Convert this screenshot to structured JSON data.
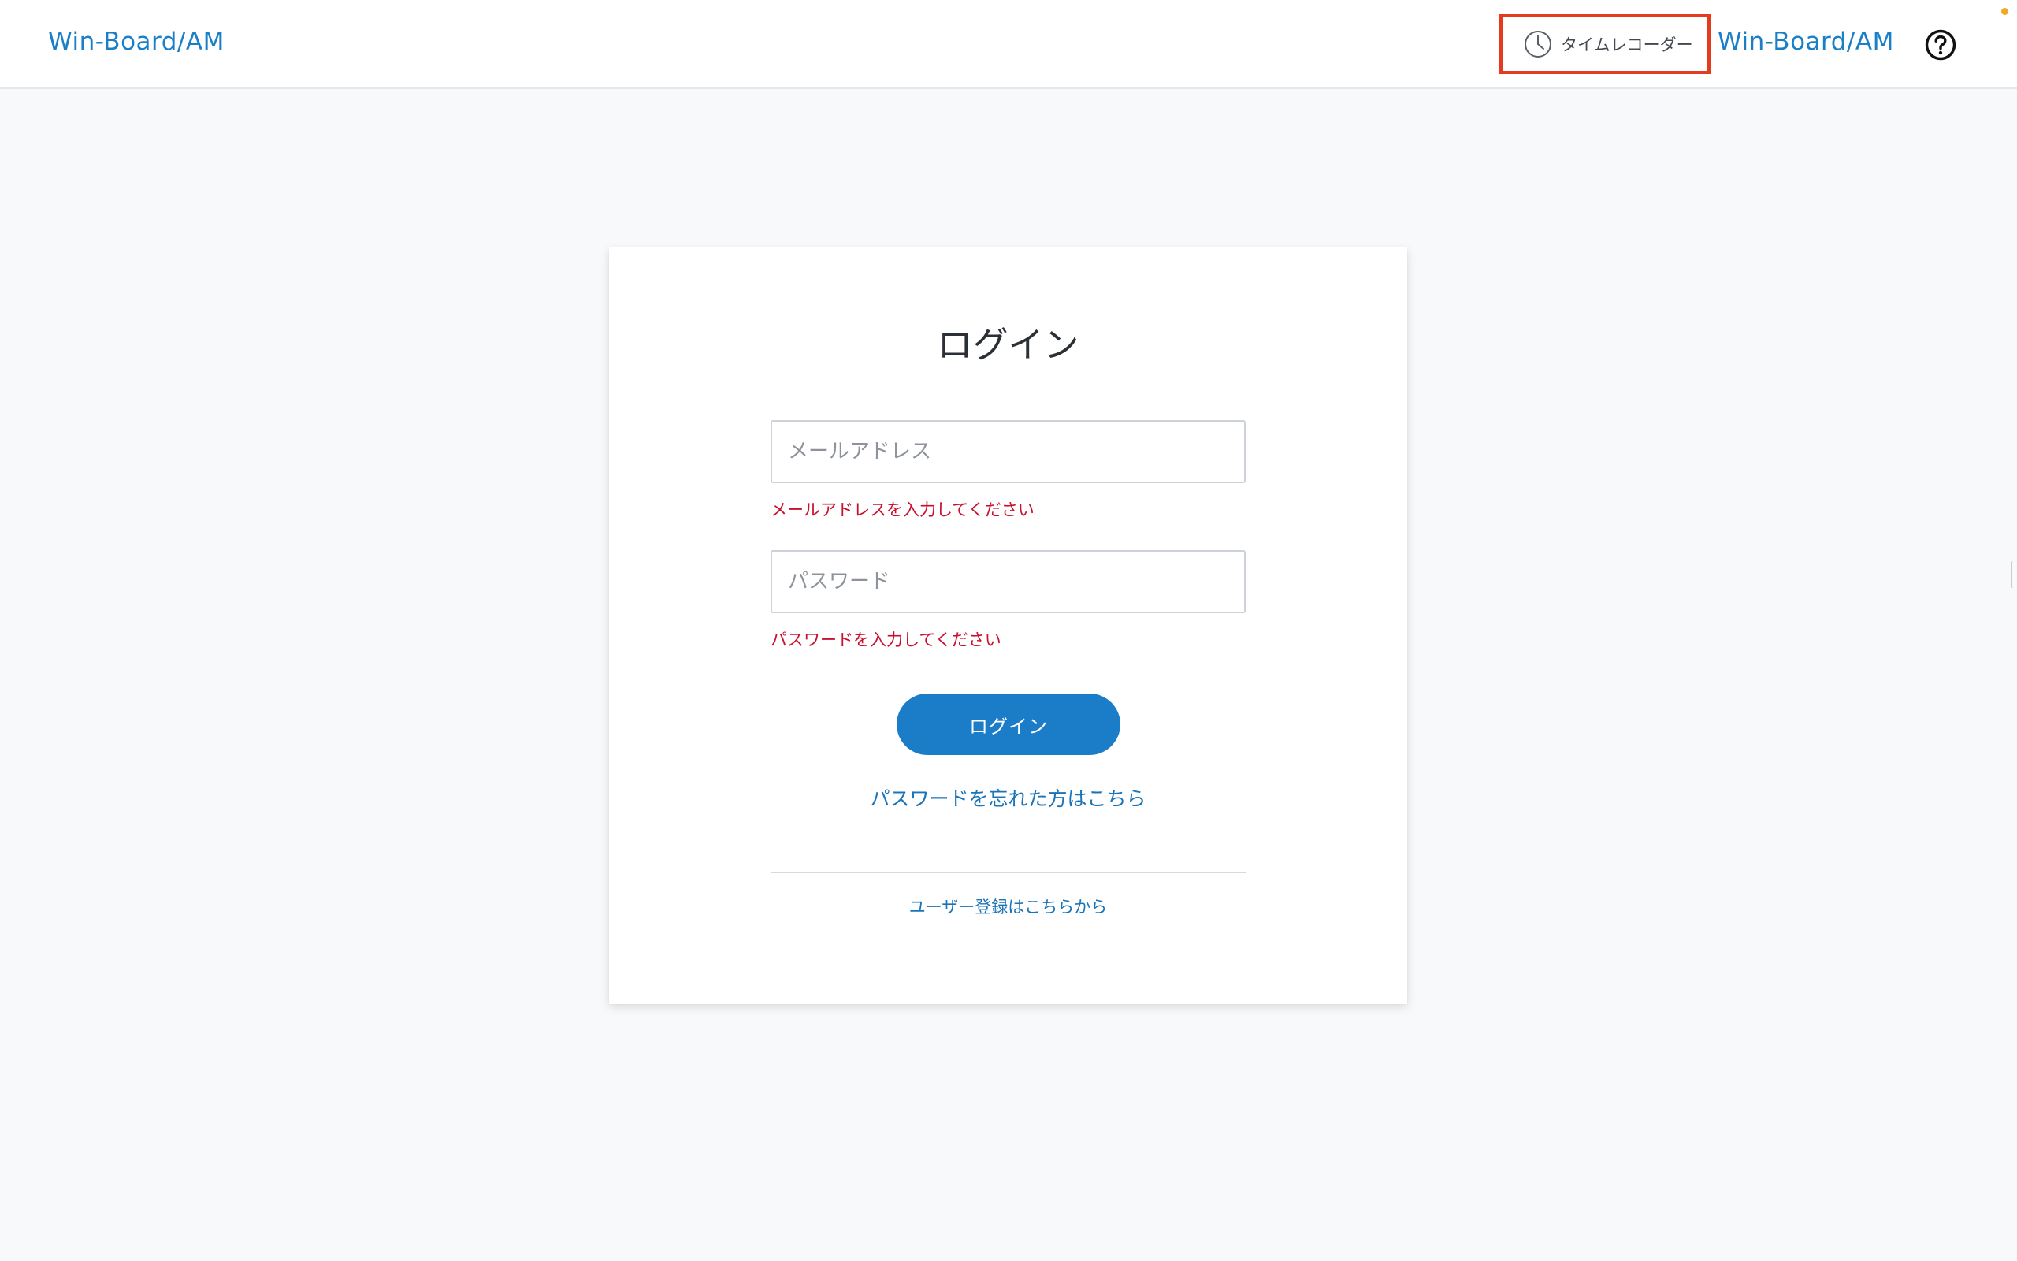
{
  "header": {
    "brand_left": "Win-Board/AM",
    "time_recorder_label": "タイムレコーダー",
    "time_recorder_icon": "clock-icon",
    "brand_right": "Win-Board/AM",
    "help_icon": "question-circle-icon"
  },
  "login": {
    "title": "ログイン",
    "email": {
      "placeholder": "メールアドレス",
      "value": "",
      "error": "メールアドレスを入力してください"
    },
    "password": {
      "placeholder": "パスワード",
      "value": "",
      "error": "パスワードを入力してください"
    },
    "submit_label": "ログイン",
    "forgot_password_link": "パスワードを忘れた方はこちら",
    "register_link": "ユーザー登録はこちらから"
  },
  "colors": {
    "accent": "#1b7cc8",
    "error": "#c8102e",
    "highlight_border": "#e23b1e",
    "background": "#f8f9fb"
  }
}
